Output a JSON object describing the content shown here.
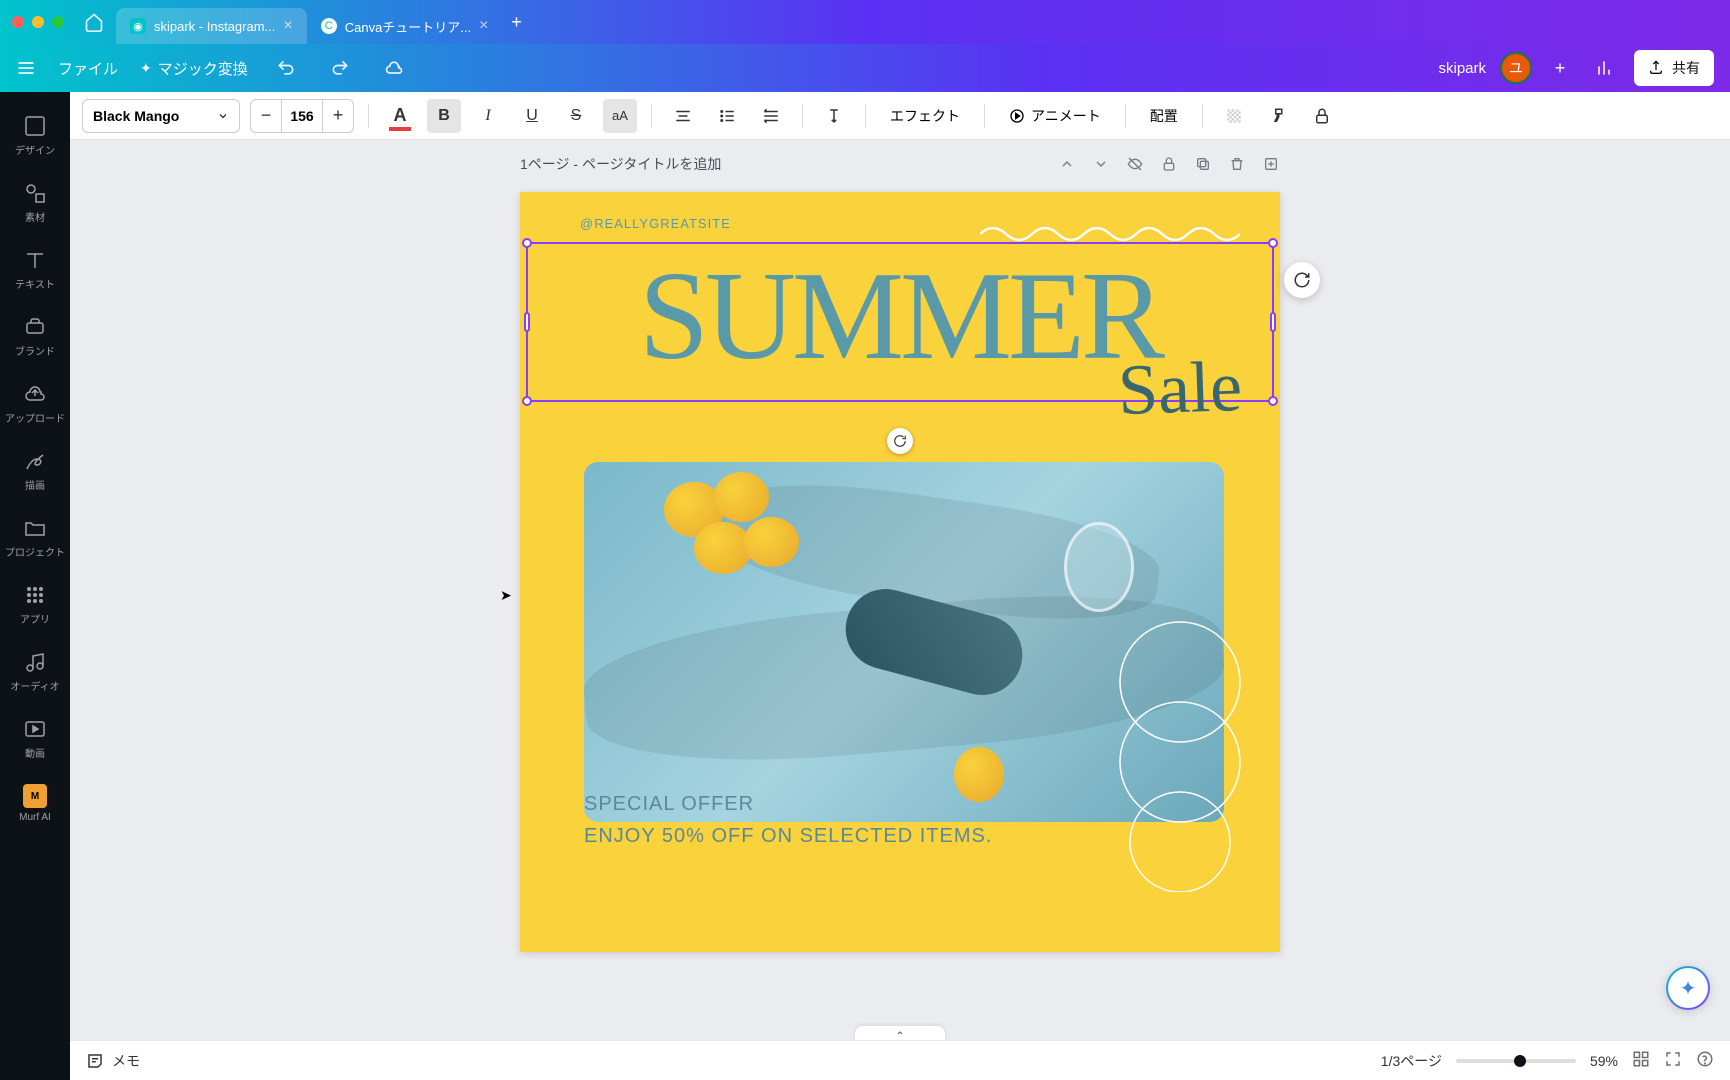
{
  "titlebar": {
    "tabs": [
      {
        "label": "skipark - Instagram...",
        "icon_bg": "#00c4cc",
        "active": true
      },
      {
        "label": "Canvaチュートリア...",
        "icon_bg": "#fff",
        "active": false
      }
    ]
  },
  "topbar": {
    "file": "ファイル",
    "magic": "マジック変換",
    "doc_name": "skipark",
    "avatar_letter": "ユ",
    "share": "共有"
  },
  "ctx": {
    "font": "Black Mango",
    "size": "156",
    "effects": "エフェクト",
    "animate": "アニメート",
    "position": "配置"
  },
  "sidebar": {
    "items": [
      {
        "label": "デザイン",
        "name": "design"
      },
      {
        "label": "素材",
        "name": "elements"
      },
      {
        "label": "テキスト",
        "name": "text"
      },
      {
        "label": "ブランド",
        "name": "brand"
      },
      {
        "label": "アップロード",
        "name": "upload"
      },
      {
        "label": "描画",
        "name": "draw"
      },
      {
        "label": "プロジェクト",
        "name": "projects"
      },
      {
        "label": "アプリ",
        "name": "apps"
      },
      {
        "label": "オーディオ",
        "name": "audio"
      },
      {
        "label": "動画",
        "name": "video"
      },
      {
        "label": "Murf AI",
        "name": "murf"
      }
    ]
  },
  "page": {
    "header": "1ページ - ページタイトルを追加",
    "handle": "@REALLYGREATSITE",
    "title": "SUMMER",
    "subtitle": "Sale",
    "offer1": "SPECIAL OFFER",
    "offer2": "ENJOY 50% OFF ON SELECTED ITEMS."
  },
  "footer": {
    "notes": "メモ",
    "pages": "1/3ページ",
    "zoom": "59%"
  },
  "colors": {
    "canvas_bg": "#f9d23c",
    "text_teal": "#5a9aa8",
    "selection": "#8b3dff"
  }
}
